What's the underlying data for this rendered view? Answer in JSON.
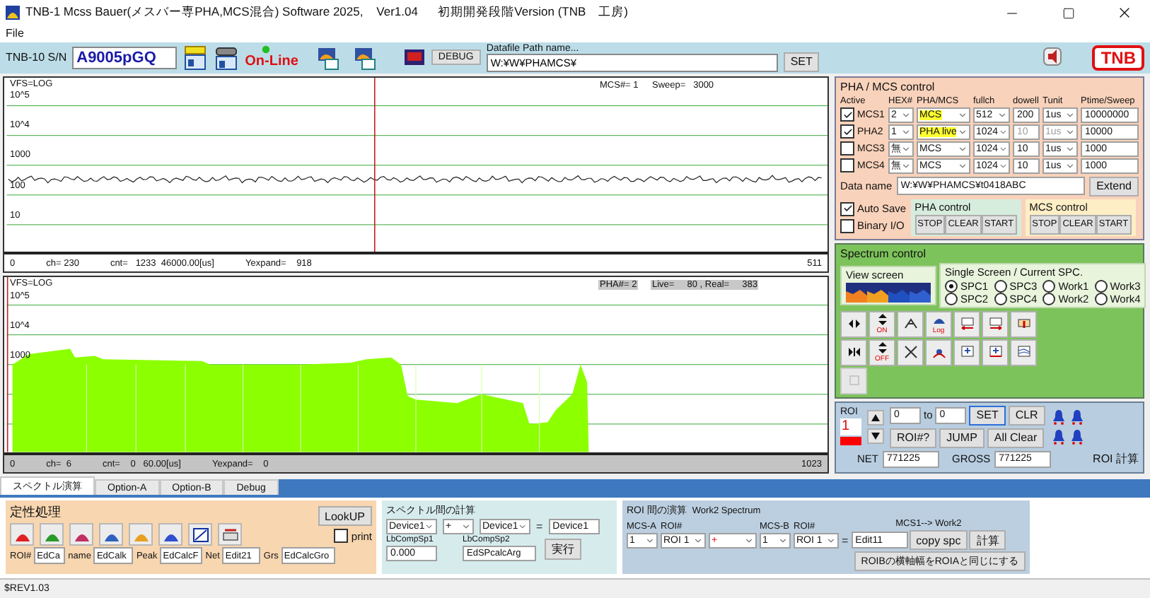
{
  "window": {
    "title": "TNB-1 Mcss Bauer(メスバー専PHA,MCS混合) Software 2025,    Ver1.04      初期開発段階Version (TNB　工房)"
  },
  "menu": [
    "File"
  ],
  "toolbar": {
    "serial_label": "TNB-10 S/N",
    "serial": "A9005pGQ",
    "status": "On-Line",
    "debug": "DEBUG",
    "path_label": "Datafile Path name...",
    "path": "W:¥W¥PHAMCS¥",
    "set": "SET",
    "logo": "TNB"
  },
  "charts": [
    {
      "kind": "mcs",
      "scale": "VFS=LOG",
      "yticks": [
        "10^5",
        "10^4",
        "1000",
        "100",
        "10"
      ],
      "info": [
        "MCS#= 1",
        "Sweep=   3000"
      ],
      "info_shaded": false,
      "footer": [
        "0",
        "ch= 230",
        "cnt=   1233  46000.00[us]",
        "Yexpand=    918"
      ],
      "footer_end": "511",
      "footer_shaded": false
    },
    {
      "kind": "pha",
      "scale": "VFS=LOG",
      "yticks": [
        "10^5",
        "10^4",
        "1000"
      ],
      "info": [
        "PHA#= 2",
        "Live=     80 , Real=     383"
      ],
      "info_shaded": true,
      "footer": [
        "0",
        "ch=  6",
        "cnt=    0   60.00[us]",
        "Yexpand=    0"
      ],
      "footer_end": "1023",
      "footer_shaded": true
    }
  ],
  "pha_mcs": {
    "title": "PHA / MCS control",
    "columns": [
      "Active",
      "HEX#",
      "PHA/MCS",
      "fullch",
      "dowell",
      "Tunit",
      "Ptime/Sweep"
    ],
    "rows": [
      {
        "name": "MCS1",
        "checked": true,
        "hex": "2",
        "mode": "MCS",
        "highlight": true,
        "fullch": "512",
        "dwell": "200",
        "disabled": false,
        "tunit": "1us",
        "ptime": "10000000"
      },
      {
        "name": "PHA2",
        "checked": true,
        "hex": "1",
        "mode": "PHA live",
        "highlight": true,
        "fullch": "1024",
        "dwell": "10",
        "disabled": true,
        "tunit": "1us",
        "ptime": "10000"
      },
      {
        "name": "MCS3",
        "checked": false,
        "hex": "無",
        "mode": "MCS",
        "highlight": false,
        "fullch": "1024",
        "dwell": "10",
        "disabled": false,
        "tunit": "1us",
        "ptime": "1000"
      },
      {
        "name": "MCS4",
        "checked": false,
        "hex": "無",
        "mode": "MCS",
        "highlight": false,
        "fullch": "1024",
        "dwell": "10",
        "disabled": false,
        "tunit": "1us",
        "ptime": "1000"
      }
    ],
    "data_name_label": "Data name",
    "data_name": "W:¥W¥PHAMCS¥t0418ABC",
    "extend": "Extend",
    "options": [
      {
        "label": "Auto Save",
        "checked": true
      },
      {
        "label": "Binary I/O",
        "checked": false
      }
    ],
    "groups": [
      {
        "kind": "pha",
        "title": "PHA control",
        "buttons": [
          "STOP",
          "CLEAR",
          "START"
        ]
      },
      {
        "kind": "mcs",
        "title": "MCS control",
        "buttons": [
          "STOP",
          "CLEAR",
          "START"
        ]
      }
    ]
  },
  "spectrum": {
    "title": "Spectrum control",
    "view_title": "View screen",
    "single_title": "Single Screen / Current SPC.",
    "spc": [
      {
        "label": "SPC1",
        "selected": true
      },
      {
        "label": "SPC3",
        "selected": false
      },
      {
        "label": "Work1",
        "selected": false
      },
      {
        "label": "Work3",
        "selected": false
      },
      {
        "label": "SPC2",
        "selected": false
      },
      {
        "label": "SPC4",
        "selected": false
      },
      {
        "label": "Work2",
        "selected": false
      },
      {
        "label": "Work4",
        "selected": false
      }
    ],
    "tools": [
      {
        "kind": "expand",
        "disabled": false
      },
      {
        "kind": "updown",
        "label": "ON",
        "disabled": false
      },
      {
        "kind": "peakup",
        "disabled": false
      },
      {
        "kind": "log",
        "label": "Log",
        "disabled": false
      },
      {
        "kind": "left",
        "disabled": false
      },
      {
        "kind": "right",
        "disabled": false
      },
      {
        "kind": "wide",
        "disabled": false
      },
      {
        "kind": "shrink",
        "disabled": false
      },
      {
        "kind": "updown",
        "label": "OFF",
        "disabled": false
      },
      {
        "kind": "peakdown",
        "disabled": false
      },
      {
        "kind": "marker",
        "disabled": false
      },
      {
        "kind": "chleft",
        "disabled": false
      },
      {
        "kind": "chright",
        "disabled": false
      },
      {
        "kind": "overlay",
        "disabled": false
      },
      {
        "kind": "blank",
        "disabled": true
      }
    ]
  },
  "roi": {
    "title": "ROI",
    "number": "1",
    "color": "#ff0000",
    "from": "0",
    "to_label": "to",
    "to": "0",
    "buttons": [
      {
        "label": "SET",
        "focused": true
      },
      {
        "label": "CLR",
        "focused": false
      },
      {
        "label": "ROI#?",
        "focused": false
      },
      {
        "label": "JUMP",
        "focused": false
      },
      {
        "label": "All Clear",
        "focused": false
      }
    ],
    "net_label": "NET",
    "net": "771225",
    "gross_label": "GROSS",
    "gross": "771225",
    "calc": "ROI 計算"
  },
  "bottom": {
    "tabs": [
      {
        "label": "スペクトル演算",
        "selected": true
      },
      {
        "label": "Option-A",
        "selected": false
      },
      {
        "label": "Option-B",
        "selected": false
      },
      {
        "label": "Debug",
        "selected": false
      }
    ],
    "qual": {
      "title": "定性処理",
      "tools": [
        {
          "kind": "peak"
        },
        {
          "kind": "auto"
        },
        {
          "kind": "fit"
        },
        {
          "kind": "smooth"
        },
        {
          "kind": "roileft"
        },
        {
          "kind": "roiright"
        },
        {
          "kind": "ecal"
        },
        {
          "kind": "print"
        }
      ],
      "lookup": "LookUP",
      "print": {
        "label": "print",
        "checked": false
      },
      "fields": [
        {
          "label": "ROI#",
          "value": "EdCa"
        },
        {
          "label": "name",
          "value": "EdCalk"
        },
        {
          "label": "Peak",
          "value": "EdCalcF"
        },
        {
          "label": "Net",
          "value": "Edit21"
        },
        {
          "label": "Grs",
          "value": "EdCalcGro"
        }
      ]
    },
    "spcalc": {
      "title": "スペクトル間の計算",
      "sp1": "Device1",
      "op": "+",
      "sp2": "Device1",
      "eq": "=",
      "result": "Device1",
      "labels": [
        "LbCompSp1",
        "LbCompSp2"
      ],
      "fields": [
        "0.000",
        "EdSPcalcArg"
      ],
      "run": "実行"
    },
    "roicalc": {
      "title": "ROI 間の演算",
      "subtitle": "Work2 Spectrum",
      "labels": [
        "MCS-A",
        "ROI#",
        "MCS-B",
        "ROI#"
      ],
      "mcs_a": "1",
      "roi_a": "ROI 1",
      "op": "+",
      "mcs_b": "1",
      "roi_b": "ROI 1",
      "eq": "=",
      "field": "Edit11",
      "note": "MCS1--> Work2",
      "copy": "copy spc",
      "calc": "計算",
      "match": "ROIBの横軸幅をROIAと同じにする"
    }
  },
  "status_bar": "$REV1.03"
}
